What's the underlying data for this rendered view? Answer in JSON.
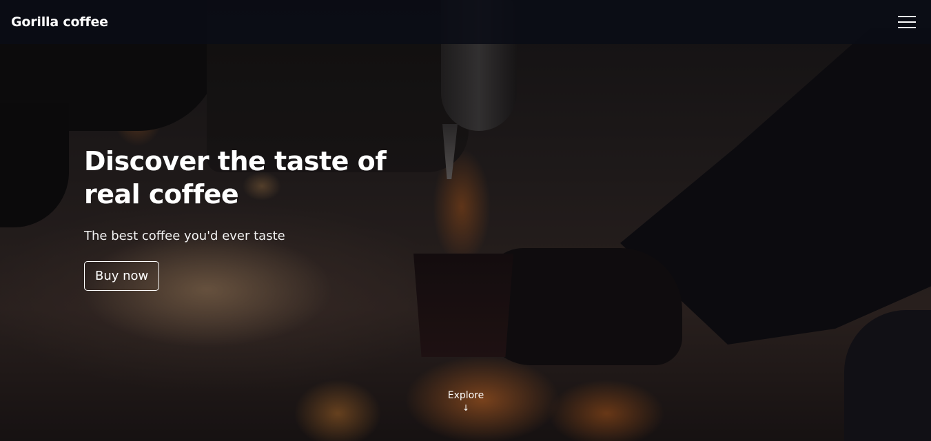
{
  "navbar": {
    "brand": "Gorilla coffee",
    "menu_icon": "hamburger-menu-icon"
  },
  "hero": {
    "headline": "Discover the taste of real coffee",
    "subheadline": "The best coffee you'd ever taste",
    "cta_label": "Buy now",
    "explore_label": "Explore",
    "explore_icon": "arrow-down-icon",
    "explore_arrow": "↓"
  },
  "colors": {
    "navbar_bg": "#0a0d16",
    "text": "#ffffff",
    "fire_accent": "#e6782a"
  }
}
